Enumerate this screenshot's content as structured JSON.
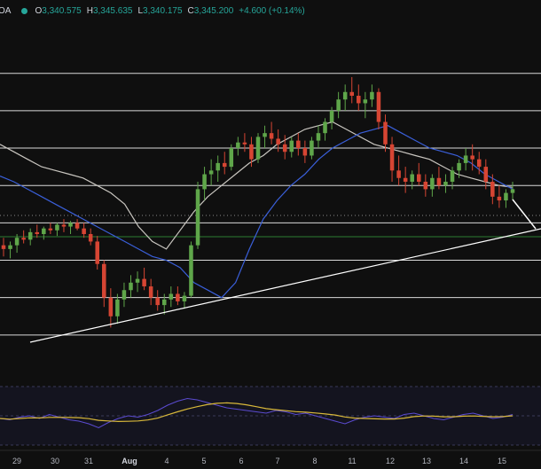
{
  "legend": {
    "symbol": "OA",
    "open_label": "O",
    "open": "3,340.575",
    "high_label": "H",
    "high": "3,345.635",
    "low_label": "L",
    "low": "3,340.175",
    "close_label": "C",
    "close": "3,345.200",
    "change": "+4.600 (+0.14%)"
  },
  "colors": {
    "background": "#0f0f0f",
    "up_candle": "#5fa64a",
    "down_candle": "#d64533",
    "ma_fast": "#3a5fd9",
    "ma_slow": "#c9c6c0",
    "rsi_line": "#5b4bd1",
    "rsi_ma": "#d8b83a",
    "trendline": "#ffffff",
    "legend_up": "#26a69a"
  },
  "x_axis": {
    "labels": [
      "29",
      "30",
      "31",
      "Aug",
      "4",
      "5",
      "6",
      "7",
      "8",
      "11",
      "12",
      "13",
      "14",
      "15"
    ]
  },
  "chart_data": {
    "type": "candlestick",
    "price_range": [
      3270,
      3455
    ],
    "horizontal_levels": [
      3430,
      3410,
      3390,
      3370,
      3350,
      3330,
      3310,
      3290
    ],
    "support_trendline": [
      [
        0,
        3290
      ],
      [
        1,
        3325
      ]
    ],
    "candles": [
      [
        3338,
        3342,
        3332,
        3336
      ],
      [
        3336,
        3340,
        3331,
        3338
      ],
      [
        3338,
        3344,
        3334,
        3342
      ],
      [
        3342,
        3346,
        3339,
        3341
      ],
      [
        3341,
        3347,
        3338,
        3345
      ],
      [
        3345,
        3349,
        3342,
        3344
      ],
      [
        3344,
        3348,
        3341,
        3347
      ],
      [
        3347,
        3350,
        3344,
        3346
      ],
      [
        3346,
        3350,
        3343,
        3349
      ],
      [
        3349,
        3352,
        3345,
        3348
      ],
      [
        3348,
        3351,
        3344,
        3350
      ],
      [
        3350,
        3352,
        3346,
        3347
      ],
      [
        3347,
        3350,
        3342,
        3344
      ],
      [
        3344,
        3347,
        3338,
        3340
      ],
      [
        3340,
        3343,
        3325,
        3328
      ],
      [
        3328,
        3330,
        3305,
        3310
      ],
      [
        3310,
        3315,
        3294,
        3300
      ],
      [
        3300,
        3312,
        3296,
        3309
      ],
      [
        3309,
        3318,
        3305,
        3314
      ],
      [
        3314,
        3322,
        3310,
        3318
      ],
      [
        3318,
        3324,
        3313,
        3320
      ],
      [
        3320,
        3326,
        3314,
        3316
      ],
      [
        3316,
        3320,
        3306,
        3310
      ],
      [
        3310,
        3314,
        3303,
        3306
      ],
      [
        3306,
        3312,
        3301,
        3309
      ],
      [
        3309,
        3316,
        3305,
        3312
      ],
      [
        3312,
        3316,
        3306,
        3308
      ],
      [
        3308,
        3313,
        3304,
        3311
      ],
      [
        3311,
        3340,
        3310,
        3338
      ],
      [
        3338,
        3372,
        3336,
        3368
      ],
      [
        3368,
        3380,
        3362,
        3376
      ],
      [
        3376,
        3384,
        3370,
        3378
      ],
      [
        3378,
        3386,
        3372,
        3382
      ],
      [
        3382,
        3388,
        3376,
        3380
      ],
      [
        3380,
        3392,
        3378,
        3390
      ],
      [
        3390,
        3396,
        3386,
        3393
      ],
      [
        3393,
        3398,
        3388,
        3392
      ],
      [
        3392,
        3396,
        3380,
        3384
      ],
      [
        3384,
        3398,
        3382,
        3396
      ],
      [
        3396,
        3402,
        3390,
        3398
      ],
      [
        3398,
        3404,
        3392,
        3395
      ],
      [
        3395,
        3400,
        3388,
        3392
      ],
      [
        3392,
        3397,
        3384,
        3388
      ],
      [
        3388,
        3396,
        3385,
        3394
      ],
      [
        3394,
        3398,
        3386,
        3390
      ],
      [
        3390,
        3394,
        3382,
        3386
      ],
      [
        3386,
        3396,
        3384,
        3394
      ],
      [
        3394,
        3402,
        3390,
        3398
      ],
      [
        3398,
        3406,
        3394,
        3404
      ],
      [
        3404,
        3412,
        3400,
        3410
      ],
      [
        3410,
        3420,
        3406,
        3416
      ],
      [
        3416,
        3424,
        3410,
        3420
      ],
      [
        3420,
        3428,
        3414,
        3418
      ],
      [
        3418,
        3424,
        3410,
        3414
      ],
      [
        3414,
        3420,
        3406,
        3416
      ],
      [
        3416,
        3424,
        3412,
        3420
      ],
      [
        3420,
        3422,
        3400,
        3404
      ],
      [
        3404,
        3408,
        3388,
        3392
      ],
      [
        3392,
        3396,
        3372,
        3378
      ],
      [
        3378,
        3386,
        3370,
        3374
      ],
      [
        3374,
        3380,
        3366,
        3372
      ],
      [
        3372,
        3378,
        3368,
        3376
      ],
      [
        3376,
        3382,
        3370,
        3372
      ],
      [
        3372,
        3376,
        3364,
        3368
      ],
      [
        3368,
        3376,
        3364,
        3374
      ],
      [
        3374,
        3380,
        3368,
        3370
      ],
      [
        3370,
        3376,
        3366,
        3372
      ],
      [
        3372,
        3380,
        3368,
        3378
      ],
      [
        3378,
        3384,
        3374,
        3382
      ],
      [
        3382,
        3390,
        3378,
        3386
      ],
      [
        3386,
        3392,
        3378,
        3384
      ],
      [
        3384,
        3388,
        3376,
        3380
      ],
      [
        3380,
        3384,
        3368,
        3372
      ],
      [
        3372,
        3376,
        3360,
        3364
      ],
      [
        3364,
        3370,
        3358,
        3362
      ],
      [
        3362,
        3368,
        3358,
        3366
      ],
      [
        3366,
        3372,
        3362,
        3368
      ]
    ],
    "ma_fast": [
      3375,
      3372,
      3368,
      3364,
      3360,
      3356,
      3352,
      3348,
      3344,
      3340,
      3336,
      3332,
      3330,
      3326,
      3318,
      3314,
      3310,
      3318,
      3336,
      3352,
      3362,
      3370,
      3376,
      3384,
      3390,
      3394,
      3398,
      3400,
      3402,
      3398,
      3394,
      3390,
      3388,
      3386,
      3382,
      3376,
      3372,
      3368
    ],
    "ma_slow": [
      3392,
      3388,
      3384,
      3380,
      3378,
      3376,
      3374,
      3370,
      3366,
      3360,
      3348,
      3340,
      3336,
      3346,
      3356,
      3364,
      3370,
      3376,
      3382,
      3386,
      3392,
      3396,
      3400,
      3402,
      3404,
      3400,
      3396,
      3392,
      3390,
      3388,
      3386,
      3384,
      3380,
      3376,
      3374,
      3372,
      3370,
      3369
    ],
    "rsi": [
      44,
      42,
      46,
      48,
      44,
      50,
      46,
      42,
      40,
      36,
      30,
      38,
      44,
      48,
      46,
      50,
      56,
      64,
      70,
      74,
      72,
      68,
      64,
      60,
      58,
      56,
      54,
      52,
      56,
      54,
      50,
      52,
      48,
      44,
      40,
      36,
      42,
      46,
      48,
      46,
      44,
      50,
      52,
      48,
      44,
      42,
      46,
      50,
      52,
      48,
      44,
      46,
      50
    ]
  }
}
